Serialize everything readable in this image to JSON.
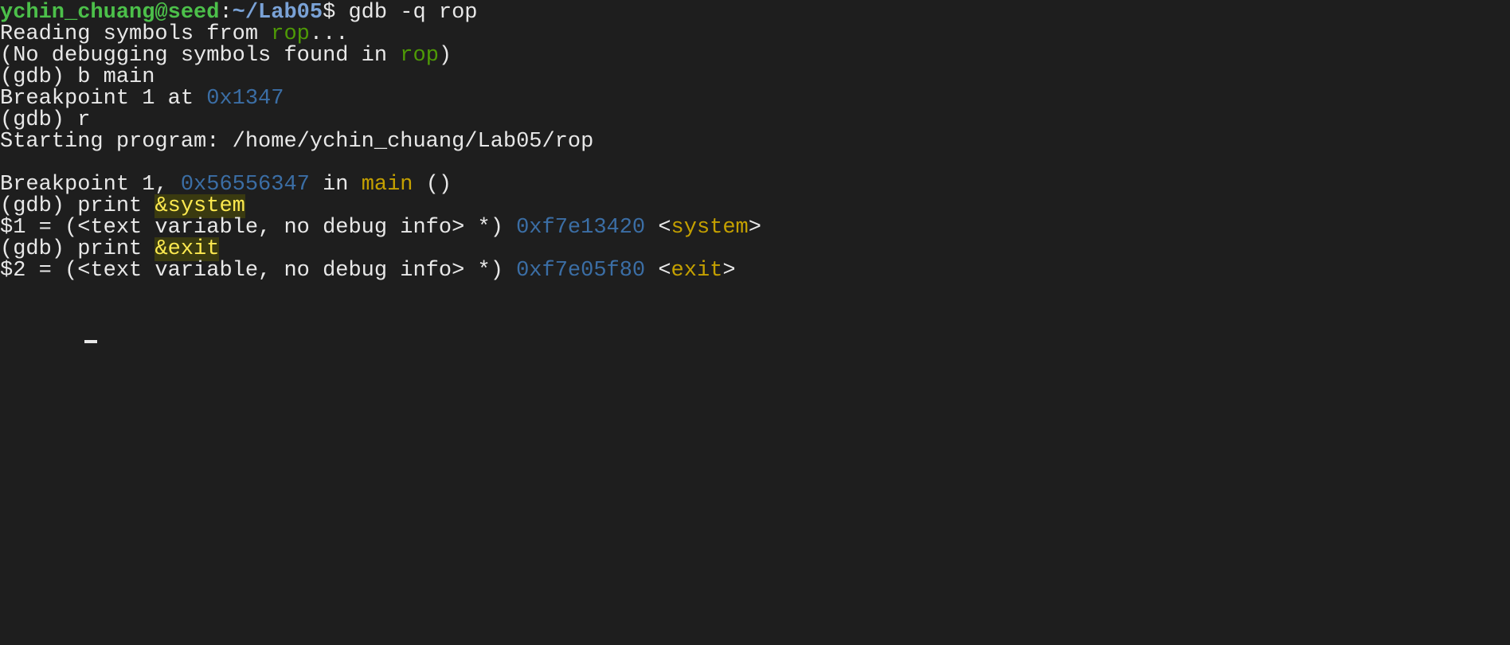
{
  "terminal": {
    "prompt_user": "ychin_chuang@seed",
    "prompt_sep": ":",
    "prompt_path": "~/Lab05",
    "prompt_end": "$ ",
    "command": "gdb -q rop",
    "l2_pre": "Reading symbols from ",
    "l2_file": "rop",
    "l2_post": "...",
    "l3_pre": "(No debugging symbols found in ",
    "l3_file": "rop",
    "l3_post": ")",
    "l4": "(gdb) b main",
    "l5_pre": "Breakpoint 1 at ",
    "l5_addr": "0x1347",
    "l6": "(gdb) r",
    "l7": "Starting program: /home/ychin_chuang/Lab05/rop",
    "l9_pre": "Breakpoint 1, ",
    "l9_addr": "0x56556347",
    "l9_in": " in ",
    "l9_func": "main",
    "l9_post": " ()",
    "l10_pre": "(gdb) print ",
    "l10_arg": "&system",
    "l11_pre": "$1 = (<text variable, no debug info> *) ",
    "l11_addr": "0xf7e13420",
    "l11_lt": " <",
    "l11_sym": "system",
    "l11_gt": ">",
    "l12_pre": "(gdb) print ",
    "l12_arg": "&exit",
    "l13_pre": "$2 = (<text variable, no debug info> *) ",
    "l13_addr": "0xf7e05f80",
    "l13_lt": " <",
    "l13_sym": "exit",
    "l13_gt": ">"
  },
  "colors": {
    "background": "#1e1e1e",
    "text": "#e8e8e8",
    "prompt_user": "#4cc04a",
    "prompt_path": "#7aa2d6",
    "filename": "#4e9a06",
    "address": "#3b6ea5",
    "symbol": "#c4a000",
    "highlight": "#fce94f"
  }
}
